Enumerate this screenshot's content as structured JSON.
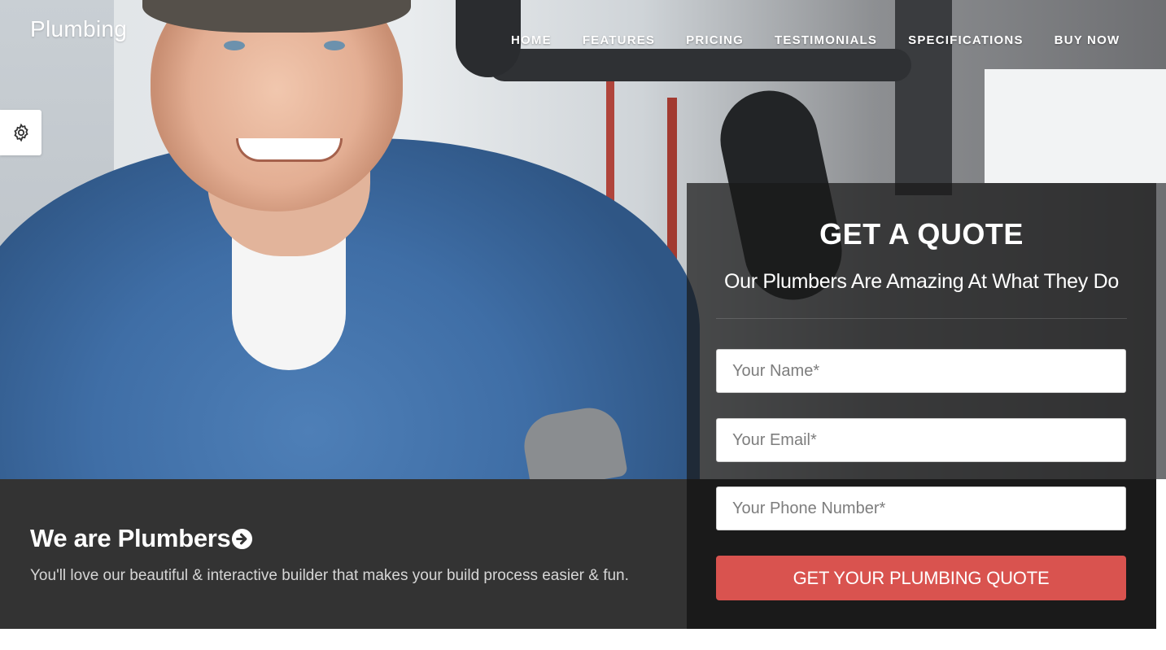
{
  "brand": "Plumbing",
  "nav": {
    "items": [
      "HOME",
      "FEATURES",
      "PRICING",
      "TESTIMONIALS",
      "SPECIFICATIONS",
      "BUY NOW"
    ]
  },
  "settings": {
    "icon": "gear-icon"
  },
  "intro": {
    "title": "We are Plumbers",
    "title_icon": "arrow-circle-right-icon",
    "text": "You'll love our beautiful & interactive builder that makes your build process easier & fun."
  },
  "quote": {
    "title": "GET A QUOTE",
    "subtitle": "Our Plumbers Are Amazing At What They Do",
    "fields": {
      "name_placeholder": "Your Name*",
      "email_placeholder": "Your Email*",
      "phone_placeholder": "Your Phone Number*"
    },
    "submit_label": "GET YOUR PLUMBING QUOTE"
  },
  "colors": {
    "accent": "#d9534f",
    "dark_strip": "#333333",
    "panel": "#1a1a1a"
  }
}
